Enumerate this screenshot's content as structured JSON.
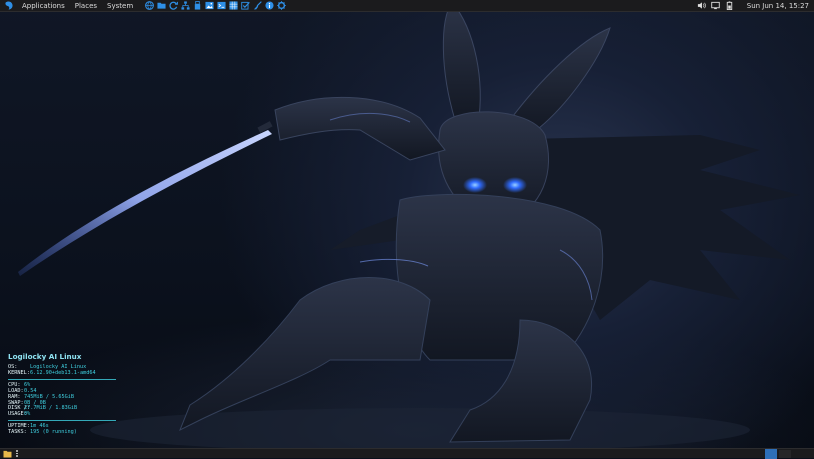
{
  "top_panel": {
    "menus": [
      "Applications",
      "Places",
      "System"
    ],
    "launchers": [
      {
        "icon": "globe-browser-icon",
        "color": "#2e8fe6"
      },
      {
        "icon": "folder-icon",
        "color": "#2e8fe6"
      },
      {
        "icon": "refresh-icon",
        "color": "#2e8fe6"
      },
      {
        "icon": "network-tree-icon",
        "color": "#2e8fe6"
      },
      {
        "icon": "usb-device-icon",
        "color": "#2e8fe6"
      },
      {
        "icon": "image-viewer-icon",
        "color": "#2e8fe6"
      },
      {
        "icon": "terminal-icon",
        "color": "#2e8fe6"
      },
      {
        "icon": "calculator-icon",
        "color": "#2e8fe6"
      },
      {
        "icon": "task-check-icon",
        "color": "#2e8fe6"
      },
      {
        "icon": "cleaner-brush-icon",
        "color": "#2e8fe6"
      },
      {
        "icon": "info-icon",
        "color": "#2e8fe6"
      },
      {
        "icon": "settings-gear-icon",
        "color": "#2e8fe6"
      }
    ],
    "clock": "Sun Jun 14, 15:27"
  },
  "conky": {
    "title": "Logilocky AI Linux",
    "os_key": "OS:",
    "os_val": "Logilocky AI Linux",
    "kernel_key": "KERNEL:",
    "kernel_val": "6.12.90+deb13.1-amd64",
    "cpu_key": "CPU:",
    "cpu_val": "6%",
    "load_key": "LOAD:",
    "load_val": "0.54",
    "ram_key": "RAM:",
    "ram_val": "745MiB / 5.65GiB",
    "swap_key": "SWAP:",
    "swap_val": "0B / 0B",
    "disk_key": "DISK /:",
    "disk_val": "27.7MiB / 1.83GiB",
    "usage_key": "USAGE:",
    "usage_val": "0%",
    "uptime_key": "UPTIME:",
    "uptime_val": "1m 46s",
    "tasks_key": "TASKS:",
    "tasks_val": "195 (0 running)"
  },
  "colors": {
    "panel_bg": "#1b1b1d",
    "accent_blue": "#2e8fe6",
    "conky_cyan": "#3fd0e0",
    "workspace_active": "#2e6fb8"
  }
}
